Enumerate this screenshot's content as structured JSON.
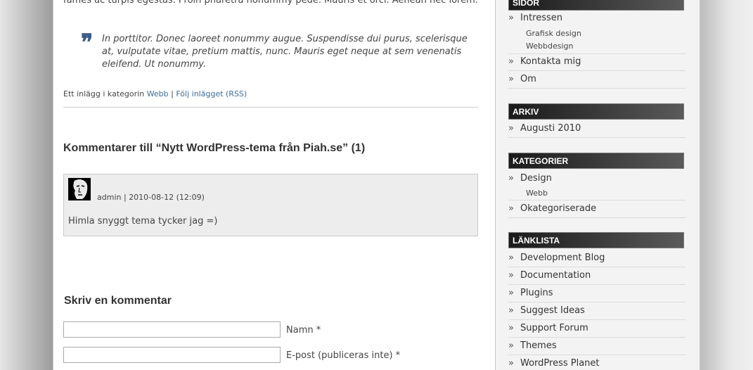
{
  "post": {
    "intro_text": "fames ac turpis egestas. Proin pharetra nonummy pede. Mauris et orci. Aenean nec lorem.",
    "quote_mark": "❞",
    "quote_text": "In porttitor. Donec laoreet nonummy augue. Suspendisse dui purus, scelerisque at, vulputate vitae, pretium mattis, nunc. Mauris eget neque at sem venenatis eleifend. Ut nonummy.",
    "meta_prefix": "Ett inlägg i kategorin",
    "meta_category": "Webb",
    "meta_separator": "|",
    "meta_rss": "Följ inlägget (RSS)"
  },
  "comments": {
    "title": "Kommentarer till “Nytt WordPress-tema från Piah.se” (1)",
    "items": [
      {
        "author": "admin",
        "separator": "|",
        "date": "2010-08-12 (12:09)",
        "text": "Himla snyggt tema tycker jag =)"
      }
    ]
  },
  "form": {
    "title": "Skriv en kommentar",
    "name_label": "Namn *",
    "name_value": "",
    "email_label": "E-post (publiceras inte) *",
    "email_value": ""
  },
  "sidebar": {
    "arrow": "»",
    "pages": {
      "heading": "SIDOR",
      "items": [
        {
          "label": "Intressen",
          "children": [
            "Grafisk design",
            "Webbdesign"
          ]
        },
        {
          "label": "Kontakta mig"
        },
        {
          "label": "Om"
        }
      ]
    },
    "archive": {
      "heading": "ARKIV",
      "items": [
        "Augusti 2010"
      ]
    },
    "categories": {
      "heading": "KATEGORIER",
      "items": [
        {
          "label": "Design",
          "children": [
            "Webb"
          ]
        },
        {
          "label": "Okategoriserade"
        }
      ]
    },
    "links": {
      "heading": "LÄNKLISTA",
      "items": [
        "Development Blog",
        "Documentation",
        "Plugins",
        "Suggest Ideas",
        "Support Forum",
        "Themes",
        "WordPress Planet"
      ]
    }
  },
  "colors": {
    "link": "#3b6d9a",
    "quote_mark": "#3a5f8a",
    "comment_bg": "#ededed",
    "sidebar_bg": "#f3f3f3"
  }
}
